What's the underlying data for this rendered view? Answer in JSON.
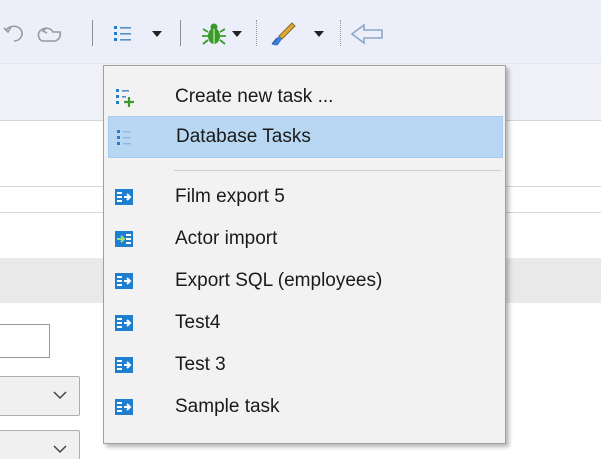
{
  "toolbar": {
    "icons": [
      "undo-icon",
      "redo-icon",
      "task-list-icon",
      "dropdown-arrow-icon",
      "debug-bug-icon",
      "dropdown-arrow-icon",
      "brush-icon",
      "dropdown-arrow-icon",
      "back-arrow-icon"
    ]
  },
  "menu": {
    "create_task": {
      "label": "Create new task ...",
      "icon": "add-task-icon"
    },
    "database_tasks": {
      "label": "Database Tasks",
      "icon": "task-list-icon",
      "selected": true
    },
    "tasks": [
      {
        "label": "Film export 5",
        "icon": "export-task-icon"
      },
      {
        "label": "Actor import",
        "icon": "import-task-icon"
      },
      {
        "label": "Export SQL (employees)",
        "icon": "export-task-icon"
      },
      {
        "label": "Test4",
        "icon": "export-task-icon"
      },
      {
        "label": "Test 3",
        "icon": "export-task-icon"
      },
      {
        "label": "Sample task",
        "icon": "export-task-icon"
      }
    ]
  },
  "colors": {
    "toolbar_bg": "#eceefa",
    "menu_bg": "#f2f2f2",
    "selection_bg": "#b8d7f3",
    "icon_blue": "#1e7fd0",
    "bug_green": "#3a9a2a"
  }
}
